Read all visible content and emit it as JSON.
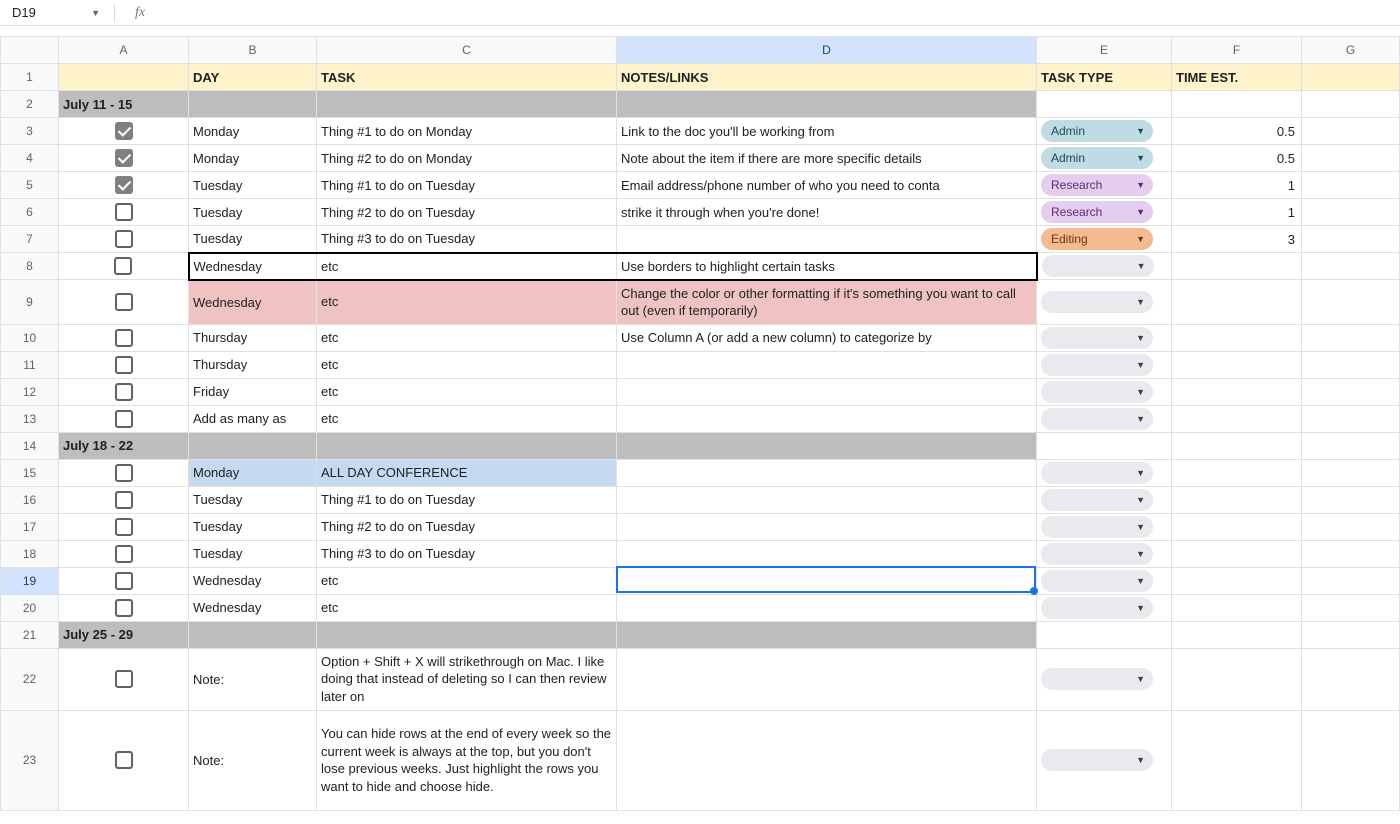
{
  "nameBox": {
    "ref": "D19"
  },
  "columns": [
    "A",
    "B",
    "C",
    "D",
    "E",
    "F",
    "G"
  ],
  "selectedColumn": "D",
  "selectedRow": 19,
  "headerRow": {
    "b": "DAY",
    "c": "TASK",
    "d": "NOTES/LINKS",
    "e": "TASK TYPE",
    "f": "TIME EST."
  },
  "chipLabels": {
    "admin": "Admin",
    "research": "Research",
    "editing": "Editing"
  },
  "rows": [
    {
      "n": 1,
      "type": "headers"
    },
    {
      "n": 2,
      "type": "section",
      "a": "July 11 - 15"
    },
    {
      "n": 3,
      "type": "data",
      "chk": true,
      "b": "Monday",
      "c": "Thing #1 to do on Monday",
      "d": "Link to the doc you'll be working from",
      "chip": "admin",
      "f": "0.5"
    },
    {
      "n": 4,
      "type": "data",
      "chk": true,
      "b": "Monday",
      "c": "Thing #2 to do on Monday",
      "d": "Note about the item if there are more specific details",
      "chip": "admin",
      "f": "0.5"
    },
    {
      "n": 5,
      "type": "data",
      "chk": true,
      "b": "Tuesday",
      "c": "Thing #1 to do on Tuesday",
      "d": "Email address/phone number of who you need to conta",
      "chip": "research",
      "f": "1"
    },
    {
      "n": 6,
      "type": "data",
      "chk": false,
      "b": "Tuesday",
      "c": "Thing #2 to do on Tuesday",
      "d": "strike it through when you're done!",
      "chip": "research",
      "f": "1"
    },
    {
      "n": 7,
      "type": "data",
      "chk": false,
      "b": "Tuesday",
      "c": "Thing #3 to do on Tuesday",
      "d": "",
      "chip": "editing",
      "f": "3"
    },
    {
      "n": 8,
      "type": "data",
      "chk": false,
      "b": "Wednesday",
      "c": "etc",
      "d": "Use borders to highlight certain tasks",
      "chip": "empty",
      "f": "",
      "boldBorder": true
    },
    {
      "n": 9,
      "type": "data",
      "chk": false,
      "b": "Wednesday",
      "c": "etc",
      "d": "Change the color or other formatting if it's something you want to call out (even if temporarily)",
      "chip": "empty",
      "f": "",
      "pink": true,
      "wrap": true,
      "tall": 44
    },
    {
      "n": 10,
      "type": "data",
      "chk": false,
      "b": "Thursday",
      "c": "etc",
      "d": "Use Column A (or add a new column) to categorize by",
      "chip": "empty",
      "f": ""
    },
    {
      "n": 11,
      "type": "data",
      "chk": false,
      "b": "Thursday",
      "c": "etc",
      "d": "",
      "chip": "empty",
      "f": ""
    },
    {
      "n": 12,
      "type": "data",
      "chk": false,
      "b": "Friday",
      "c": "etc",
      "d": "",
      "chip": "empty",
      "f": ""
    },
    {
      "n": 13,
      "type": "data",
      "chk": false,
      "b": "Add as many as",
      "c": "etc",
      "d": "",
      "chip": "empty",
      "f": ""
    },
    {
      "n": 14,
      "type": "section",
      "a": "July 18 - 22"
    },
    {
      "n": 15,
      "type": "data",
      "chk": false,
      "b": "Monday",
      "c": "ALL DAY CONFERENCE",
      "d": "",
      "chip": "empty",
      "f": "",
      "blue": true
    },
    {
      "n": 16,
      "type": "data",
      "chk": false,
      "b": "Tuesday",
      "c": "Thing #1 to do on Tuesday",
      "d": "",
      "chip": "empty",
      "f": ""
    },
    {
      "n": 17,
      "type": "data",
      "chk": false,
      "b": "Tuesday",
      "c": "Thing #2 to do on Tuesday",
      "d": "",
      "chip": "empty",
      "f": ""
    },
    {
      "n": 18,
      "type": "data",
      "chk": false,
      "b": "Tuesday",
      "c": "Thing #3 to do on Tuesday",
      "d": "",
      "chip": "empty",
      "f": ""
    },
    {
      "n": 19,
      "type": "data",
      "chk": false,
      "b": "Wednesday",
      "c": "etc",
      "d": "",
      "chip": "empty",
      "f": ""
    },
    {
      "n": 20,
      "type": "data",
      "chk": false,
      "b": "Wednesday",
      "c": "etc",
      "d": "",
      "chip": "empty",
      "f": ""
    },
    {
      "n": 21,
      "type": "section",
      "a": "July 25 - 29"
    },
    {
      "n": 22,
      "type": "data",
      "chk": false,
      "b": "Note:",
      "c": "Option + Shift + X will strikethrough on Mac. I like doing that instead of deleting so I can then review later on",
      "d": "",
      "chip": "empty",
      "f": "",
      "wrap": true,
      "tall": 62
    },
    {
      "n": 23,
      "type": "data",
      "chk": false,
      "b": "Note:",
      "c": "You can hide rows at the end of every week so the current week is always at the top, but you don't lose previous weeks. Just highlight the rows you want to hide and choose hide.",
      "d": "",
      "chip": "empty",
      "f": "",
      "wrap": true,
      "tall": 100
    }
  ]
}
